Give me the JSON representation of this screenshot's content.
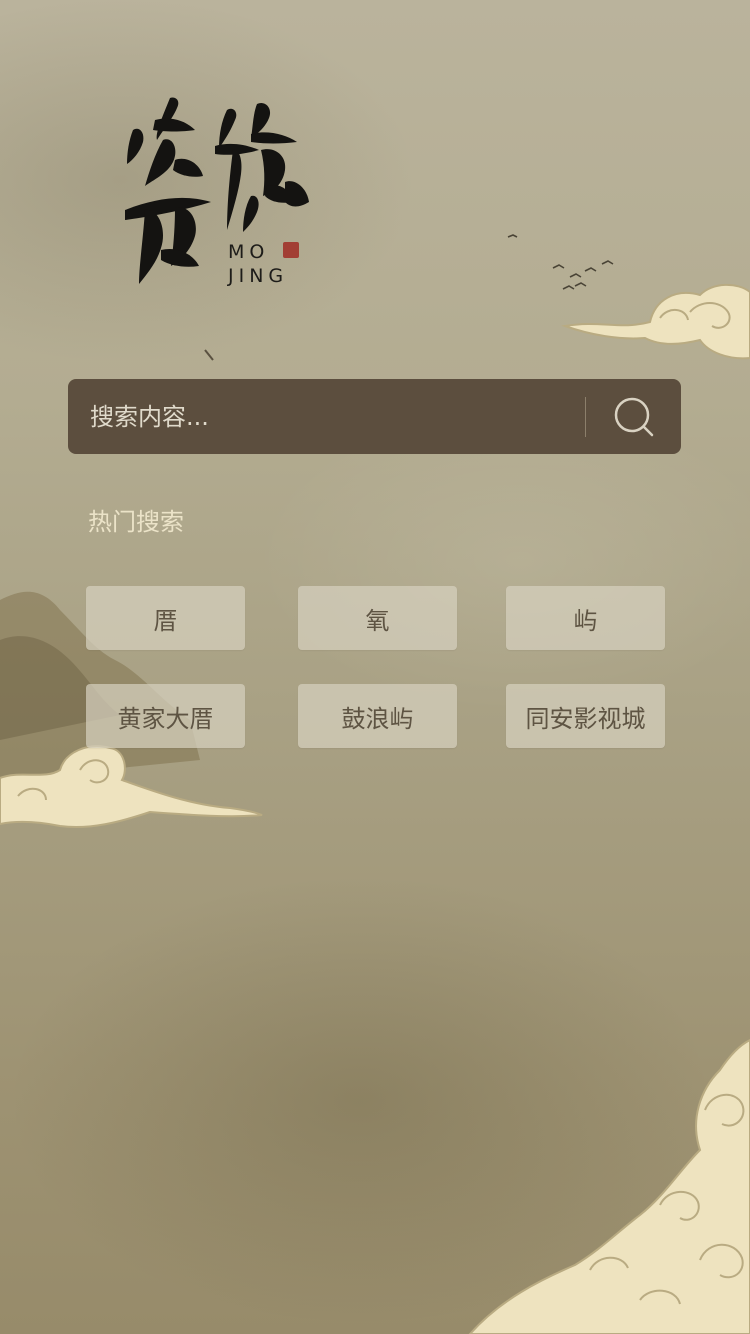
{
  "logo": {
    "calligraphy": "墨境",
    "latin_line1": "MO",
    "latin_line2": "JING"
  },
  "search": {
    "placeholder": "搜索内容...",
    "icon": "search-icon"
  },
  "hot": {
    "title": "热门搜索",
    "tags": [
      "厝",
      "氧",
      "屿",
      "黄家大厝",
      "鼓浪屿",
      "同安影视城"
    ]
  },
  "colors": {
    "background": "#b3ac91",
    "search_bar": "#5c4e3e",
    "hot_title": "#ebe3c8",
    "tag_background": "#d6d0be",
    "tag_text": "#5e5443",
    "cloud": "#eee3bf"
  }
}
